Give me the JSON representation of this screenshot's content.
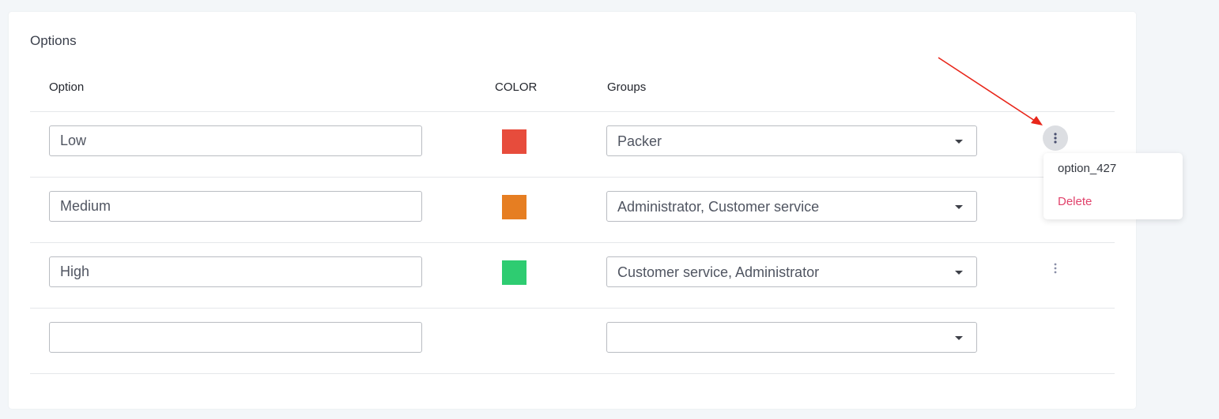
{
  "section": {
    "title": "Options"
  },
  "columns": {
    "option": "Option",
    "color": "COLOR",
    "groups": "Groups"
  },
  "rows": [
    {
      "option": "Low",
      "color": "#e74c3c",
      "groups": "Packer"
    },
    {
      "option": "Medium",
      "color": "#e67e22",
      "groups": "Administrator, Customer service"
    },
    {
      "option": "High",
      "color": "#2ecc71",
      "groups": "Customer service, Administrator"
    },
    {
      "option": "",
      "color": "",
      "groups": ""
    }
  ],
  "context_menu": {
    "option_id": "option_427",
    "delete_label": "Delete"
  },
  "annotation": {
    "arrow_color": "#e8261a"
  }
}
